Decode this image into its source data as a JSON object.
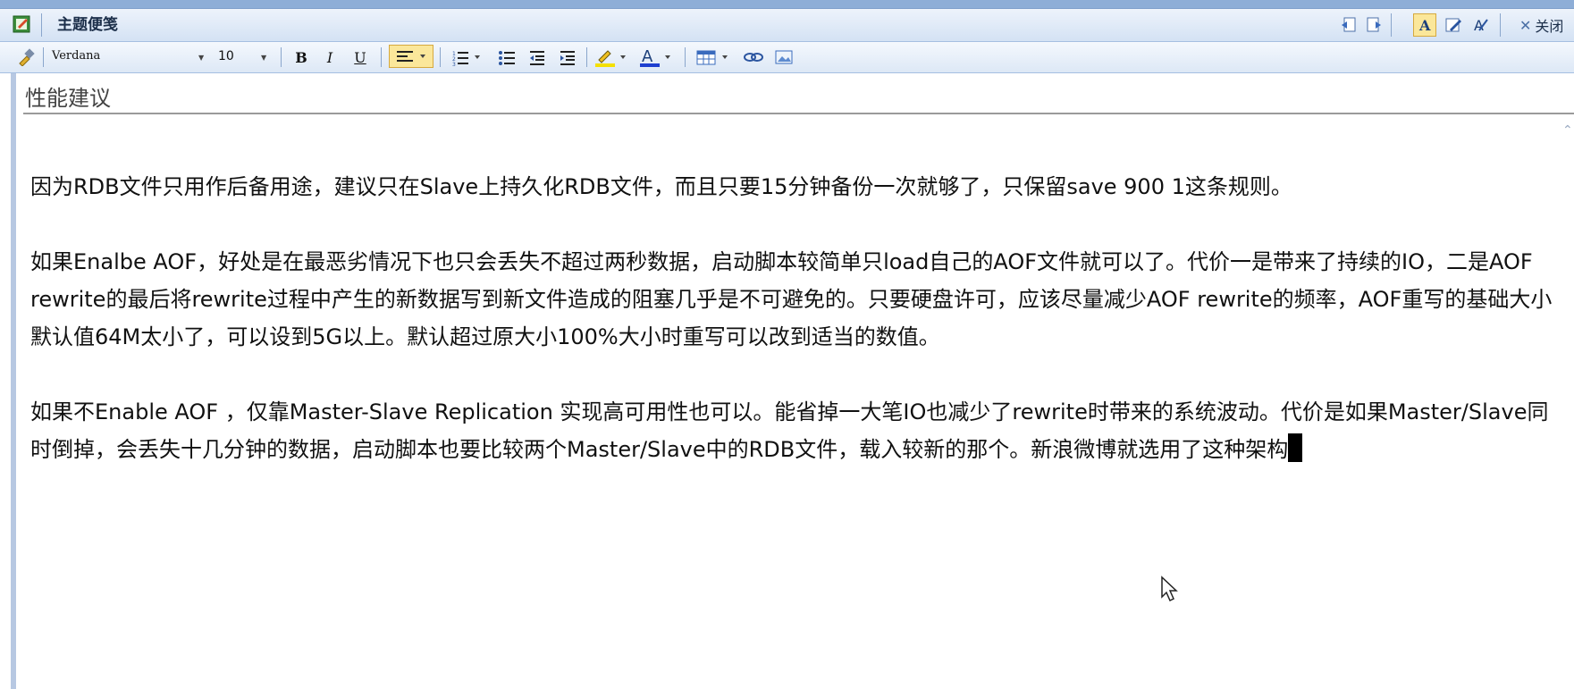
{
  "window": {
    "title": "主题便笺",
    "close_label": "关闭"
  },
  "formatting": {
    "font_family": "Verdana",
    "font_size": "10",
    "bold": "B",
    "italic": "I",
    "underline": "U",
    "font_color_letter": "A"
  },
  "note": {
    "subject": "性能建议",
    "paragraphs": [
      "因为RDB文件只用作后备用途，建议只在Slave上持久化RDB文件，而且只要15分钟备份一次就够了，只保留save 900 1这条规则。",
      "如果Enalbe AOF，好处是在最恶劣情况下也只会丢失不超过两秒数据，启动脚本较简单只load自己的AOF文件就可以了。代价一是带来了持续的IO，二是AOF rewrite的最后将rewrite过程中产生的新数据写到新文件造成的阻塞几乎是不可避免的。只要硬盘许可，应该尽量减少AOF rewrite的频率，AOF重写的基础大小默认值64M太小了，可以设到5G以上。默认超过原大小100%大小时重写可以改到适当的数值。",
      "如果不Enable AOF ，仅靠Master-Slave Replication 实现高可用性也可以。能省掉一大笔IO也减少了rewrite时带来的系统波动。代价是如果Master/Slave同时倒掉，会丢失十几分钟的数据，启动脚本也要比较两个Master/Slave中的RDB文件，载入较新的那个。新浪微博就选用了这种架构"
    ]
  },
  "colors": {
    "accent_active": "#fbe79a",
    "toolbar_bg": "#dde8f6",
    "border": "#a5bfe1"
  }
}
